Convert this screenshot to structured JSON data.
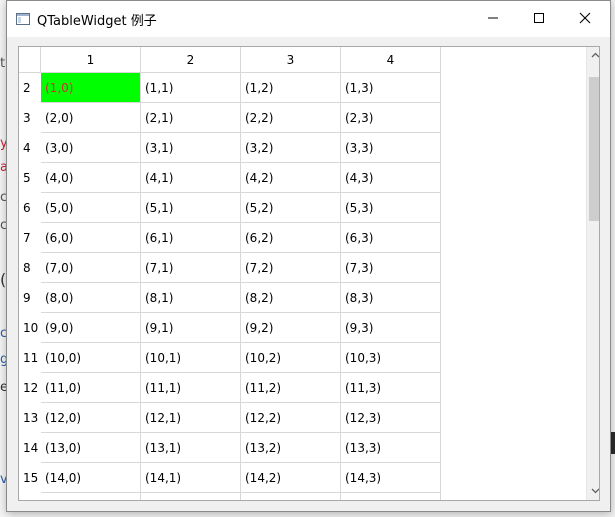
{
  "window": {
    "title": "QTableWidget 例子"
  },
  "table": {
    "column_headers": [
      "1",
      "2",
      "3",
      "4"
    ],
    "row_headers": [
      "2",
      "3",
      "4",
      "5",
      "6",
      "7",
      "8",
      "9",
      "10",
      "11",
      "12",
      "13",
      "14",
      "15",
      ""
    ],
    "rows": [
      [
        "(1,0)",
        "(1,1)",
        "(1,2)",
        "(1,3)"
      ],
      [
        "(2,0)",
        "(2,1)",
        "(2,2)",
        "(2,3)"
      ],
      [
        "(3,0)",
        "(3,1)",
        "(3,2)",
        "(3,3)"
      ],
      [
        "(4,0)",
        "(4,1)",
        "(4,2)",
        "(4,3)"
      ],
      [
        "(5,0)",
        "(5,1)",
        "(5,2)",
        "(5,3)"
      ],
      [
        "(6,0)",
        "(6,1)",
        "(6,2)",
        "(6,3)"
      ],
      [
        "(7,0)",
        "(7,1)",
        "(7,2)",
        "(7,3)"
      ],
      [
        "(8,0)",
        "(8,1)",
        "(8,2)",
        "(8,3)"
      ],
      [
        "(9,0)",
        "(9,1)",
        "(9,2)",
        "(9,3)"
      ],
      [
        "(10,0)",
        "(10,1)",
        "(10,2)",
        "(10,3)"
      ],
      [
        "(11,0)",
        "(11,1)",
        "(11,2)",
        "(11,3)"
      ],
      [
        "(12,0)",
        "(12,1)",
        "(12,2)",
        "(12,3)"
      ],
      [
        "(13,0)",
        "(13,1)",
        "(13,2)",
        "(13,3)"
      ],
      [
        "(14,0)",
        "(14,1)",
        "(14,2)",
        "(14,3)"
      ],
      [
        "",
        "",
        "",
        ""
      ]
    ],
    "highlighted_cell_bg": "#00ff00",
    "highlighted_cell_fg": "#d03030"
  },
  "icons": {
    "app": "window-icon",
    "minimize": "minimize-icon",
    "maximize": "maximize-icon",
    "close": "close-icon",
    "scroll_up": "chevron-up-icon",
    "scroll_down": "chevron-down-icon"
  },
  "background": {
    "fragments": [
      "t",
      "y",
      "a",
      "co",
      "co",
      "(",
      "c",
      "g",
      "e",
      "v"
    ]
  }
}
